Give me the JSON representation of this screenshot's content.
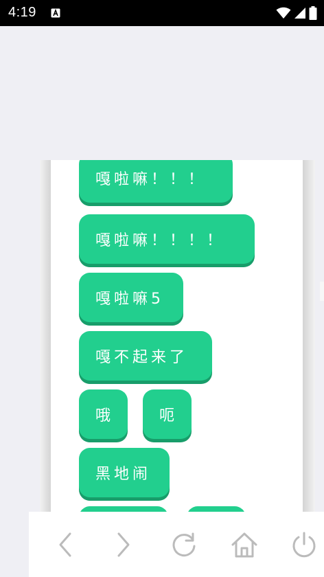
{
  "status_bar": {
    "time": "4:19",
    "icons": [
      "notification-a-icon",
      "wifi-icon",
      "cellular-signal-icon",
      "battery-icon"
    ]
  },
  "chips": [
    {
      "label": "嘎啦嘛！！！"
    },
    {
      "label": "嘎啦嘛！！！！"
    },
    {
      "label": "嘎啦嘛5"
    },
    {
      "label": "嘎不起来了"
    },
    {
      "label": "哦"
    },
    {
      "label": "呃"
    },
    {
      "label": "黑地闹"
    },
    {
      "label": ""
    },
    {
      "label": ""
    }
  ],
  "bottom_nav": {
    "icons": [
      "back-arrow-icon",
      "forward-arrow-icon",
      "refresh-icon",
      "home-icon",
      "power-icon"
    ]
  },
  "colors": {
    "chip_background": "#22cf8e",
    "chip_shadow": "#189d6a",
    "chip_text": "#ffffff",
    "nav_icon": "#bbbbbb",
    "status_bar": "#000000",
    "page_background": "#efeff4"
  }
}
